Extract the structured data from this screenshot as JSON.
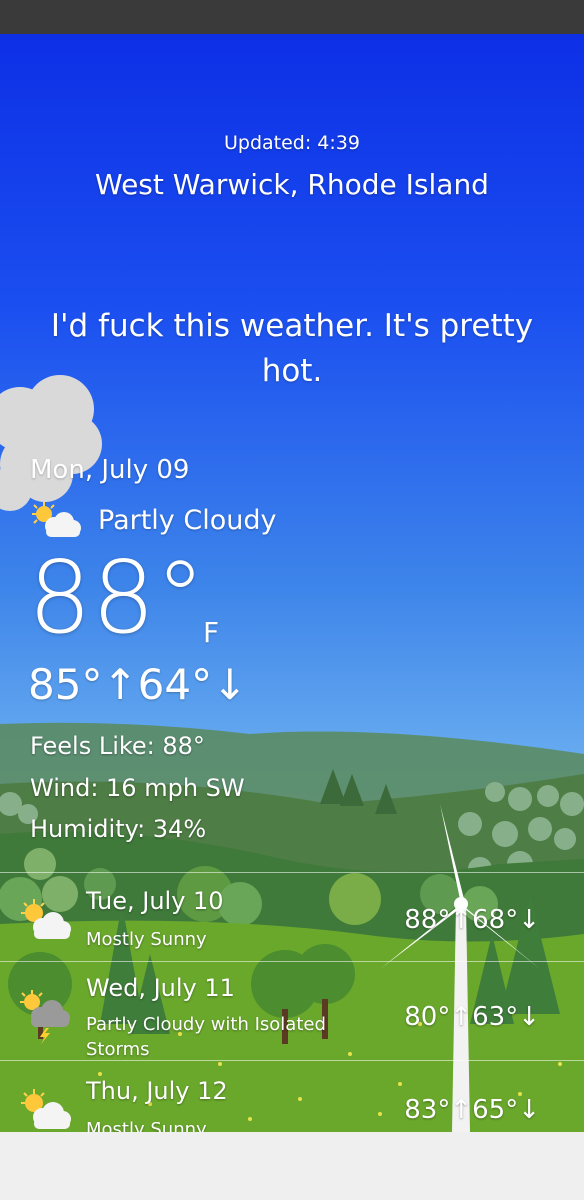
{
  "header": {
    "updated": "Updated: 4:39",
    "location": "West Warwick, Rhode Island"
  },
  "quip": "I'd fuck this weather. It's pretty hot.",
  "current": {
    "date": "Mon, July 09",
    "condition": "Partly Cloudy",
    "condition_icon": "partly-cloudy-icon",
    "temp": "88°",
    "unit": "F",
    "hilo": "85°↑64°↓",
    "feels_like": "Feels Like: 88°",
    "wind": "Wind: 16 mph SW",
    "humidity": "Humidity: 34%"
  },
  "forecast": [
    {
      "day": "Tue, July 10",
      "condition": "Mostly Sunny",
      "temps": "88°↑68°↓",
      "icon": "mostly-sunny-icon"
    },
    {
      "day": "Wed, July 11",
      "condition": "Partly Cloudy with Isolated Storms",
      "temps": "80°↑63°↓",
      "icon": "storm-icon"
    },
    {
      "day": "Thu, July 12",
      "condition": "Mostly Sunny",
      "temps": "83°↑65°↓",
      "icon": "mostly-sunny-icon"
    }
  ],
  "colors": {
    "sky_top": "#0d2fe6",
    "sky_bottom": "#9cd0f2",
    "grass": "#6aa82c",
    "status_bar": "#3a3a3a"
  }
}
